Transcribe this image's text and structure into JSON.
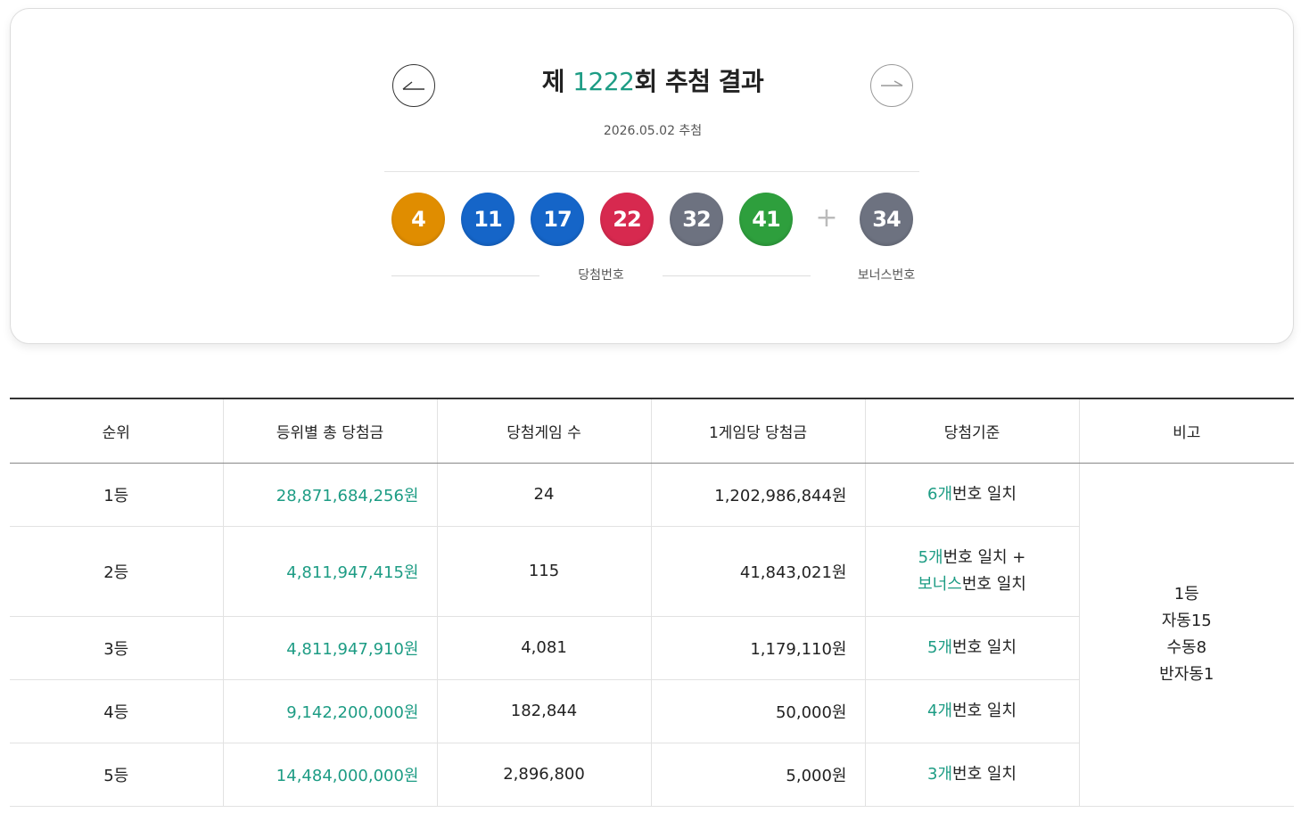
{
  "draw": {
    "title_prefix": "제 ",
    "round": "1222",
    "title_suffix": "회 추첨 결과",
    "date": "2026.05.02 추첨",
    "prev_icon": "arrow-left-icon",
    "next_icon": "arrow-right-icon",
    "winning_numbers": [
      "4",
      "11",
      "17",
      "22",
      "32",
      "41"
    ],
    "plus_sign": "+",
    "bonus_number": "34",
    "winning_label": "당첨번호",
    "bonus_label": "보너스번호",
    "ball_colors": {
      "4": "#e08d00",
      "11": "#1565c8",
      "17": "#1565c8",
      "22": "#d7294f",
      "32": "#6d7280",
      "41": "#2e9f3d",
      "34": "#6d7280"
    }
  },
  "table": {
    "headers": [
      "순위",
      "등위별 총 당첨금",
      "당첨게임 수",
      "1게임당 당첨금",
      "당첨기준",
      "비고"
    ],
    "rows": [
      {
        "rank": "1등",
        "total": "28,871,684,256원",
        "games": "24",
        "per_game": "1,202,986,844원",
        "criteria": [
          {
            "g": "6개",
            "d": "번호 일치"
          }
        ]
      },
      {
        "rank": "2등",
        "total": "4,811,947,415원",
        "games": "115",
        "per_game": "41,843,021원",
        "criteria": [
          {
            "g": "5개",
            "d": "번호 일치 +"
          },
          {
            "g": "보너스",
            "d": "번호 일치"
          }
        ]
      },
      {
        "rank": "3등",
        "total": "4,811,947,910원",
        "games": "4,081",
        "per_game": "1,179,110원",
        "criteria": [
          {
            "g": "5개",
            "d": "번호 일치"
          }
        ]
      },
      {
        "rank": "4등",
        "total": "9,142,200,000원",
        "games": "182,844",
        "per_game": "50,000원",
        "criteria": [
          {
            "g": "4개",
            "d": "번호 일치"
          }
        ]
      },
      {
        "rank": "5등",
        "total": "14,484,000,000원",
        "games": "2,896,800",
        "per_game": "5,000원",
        "criteria": [
          {
            "g": "3개",
            "d": "번호 일치"
          }
        ]
      }
    ],
    "note": [
      "1등",
      "자동15",
      "수동8",
      "반자동1"
    ]
  },
  "colors": {
    "accent": "#1d9c84",
    "text": "#222222"
  }
}
